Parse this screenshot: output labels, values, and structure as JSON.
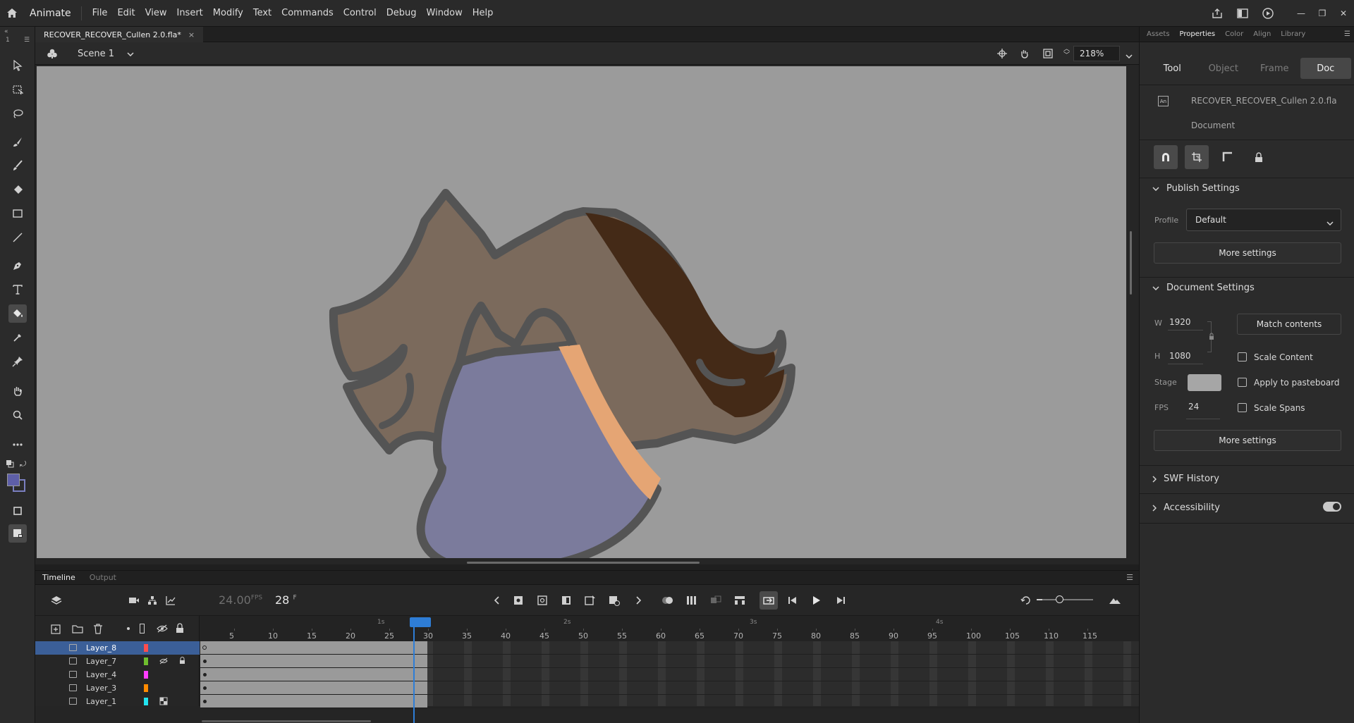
{
  "app": {
    "name": "Animate"
  },
  "menu": [
    "File",
    "Edit",
    "View",
    "Insert",
    "Modify",
    "Text",
    "Commands",
    "Control",
    "Debug",
    "Window",
    "Help"
  ],
  "document_tab": {
    "title": "RECOVER_RECOVER_Cullen 2.0.fla*",
    "close": "×"
  },
  "editbar": {
    "scene": "Scene 1",
    "zoom": "218%"
  },
  "stage": {
    "background": "#9b9b9b"
  },
  "timeline": {
    "tabs": [
      "Timeline",
      "Output"
    ],
    "fps_value": "24.00",
    "fps_unit": "FPS",
    "frame_value": "28",
    "frame_unit": "F",
    "seconds": [
      "1s",
      "2s",
      "3s",
      "4s"
    ],
    "frame_numbers": [
      "5",
      "10",
      "15",
      "20",
      "25",
      "30",
      "35",
      "40",
      "45",
      "50",
      "55",
      "60",
      "65",
      "70",
      "75",
      "80",
      "85",
      "90",
      "95",
      "100",
      "105",
      "110",
      "115"
    ],
    "current_frame": 28,
    "layers": [
      {
        "name": "Layer_8",
        "color": "#ff4d4d",
        "selected": true
      },
      {
        "name": "Layer_7",
        "color": "#6fbf2e",
        "hidden": true,
        "locked": true
      },
      {
        "name": "Layer_4",
        "color": "#ff3dff"
      },
      {
        "name": "Layer_3",
        "color": "#ff8a00"
      },
      {
        "name": "Layer_1",
        "color": "#22e4f0"
      }
    ]
  },
  "properties": {
    "panel_tabs": [
      "Assets",
      "Properties",
      "Color",
      "Align",
      "Library"
    ],
    "active_panel_tab": "Properties",
    "subtabs": [
      "Tool",
      "Object",
      "Frame",
      "Doc"
    ],
    "active_subtab": "Doc",
    "file_name": "RECOVER_RECOVER_Cullen 2.0.fla",
    "doc_type": "Document",
    "file_icon": "An",
    "publish": {
      "header": "Publish Settings",
      "profile_label": "Profile",
      "profile_value": "Default",
      "more": "More settings"
    },
    "document": {
      "header": "Document Settings",
      "w_label": "W",
      "w_value": "1920",
      "h_label": "H",
      "h_value": "1080",
      "match": "Match contents",
      "scale_content": "Scale Content",
      "stage_label": "Stage",
      "stage_color": "#a6a6a6",
      "apply_pasteboard": "Apply to pasteboard",
      "fps_label": "FPS",
      "fps_value": "24",
      "scale_spans": "Scale Spans",
      "more": "More settings"
    },
    "swf_history": "SWF History",
    "accessibility": "Accessibility"
  }
}
